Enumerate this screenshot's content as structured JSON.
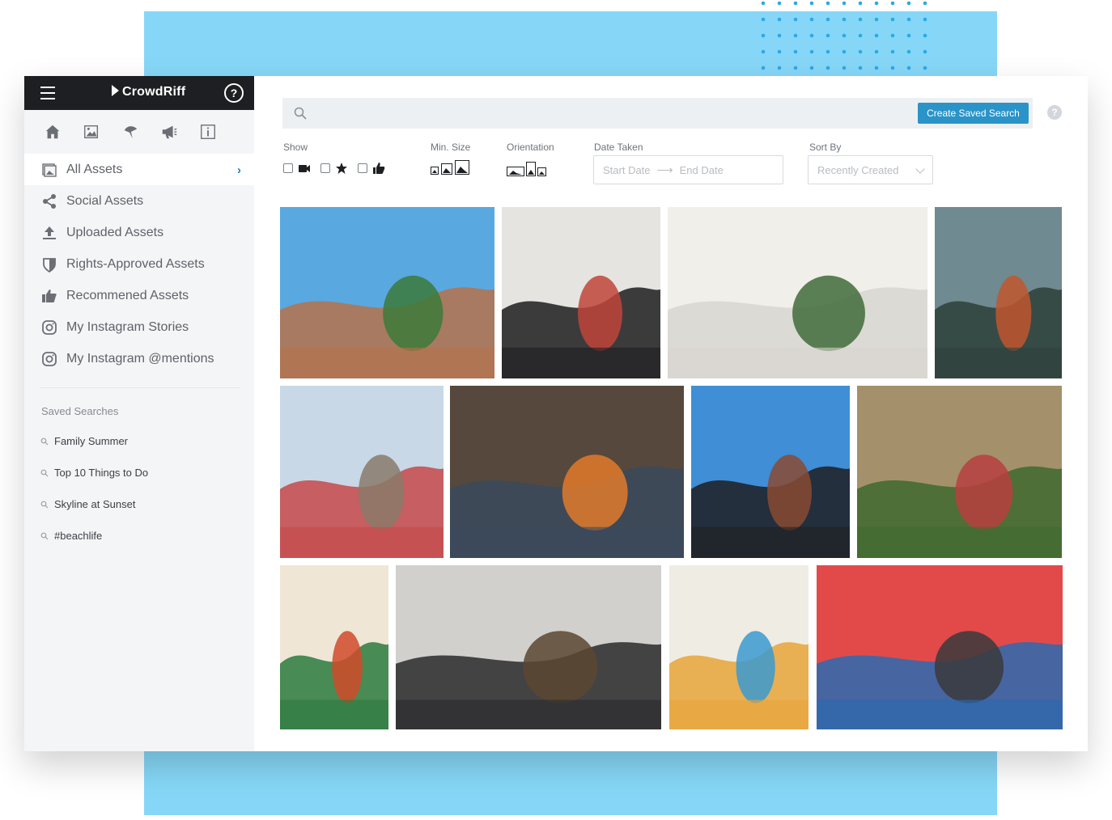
{
  "app": {
    "brand": "CrowdRiff",
    "help_symbol": "?"
  },
  "colors": {
    "accent": "#2a94c8",
    "topbar": "#1d1f22",
    "band": "#86d7f7",
    "sidebar": "#f4f5f7"
  },
  "toolbar_icons": [
    "home-icon",
    "gallery-icon",
    "campaign-icon",
    "megaphone-icon",
    "info-icon"
  ],
  "nav": {
    "items": [
      {
        "label": "All Assets",
        "icon": "all-assets-icon",
        "active": true
      },
      {
        "label": "Social Assets",
        "icon": "share-icon"
      },
      {
        "label": "Uploaded Assets",
        "icon": "upload-icon"
      },
      {
        "label": "Rights-Approved Assets",
        "icon": "shield-icon"
      },
      {
        "label": "Recommened Assets",
        "icon": "thumbs-up-icon"
      },
      {
        "label": "My Instagram Stories",
        "icon": "instagram-icon"
      },
      {
        "label": "My Instagram @mentions",
        "icon": "instagram-icon"
      }
    ]
  },
  "saved_searches": {
    "title": "Saved Searches",
    "items": [
      "Family Summer",
      "Top 10 Things to Do",
      "Skyline at Sunset",
      "#beachlife"
    ]
  },
  "search": {
    "placeholder": "",
    "create_button": "Create Saved Search",
    "help_symbol": "?"
  },
  "filters": {
    "show_label": "Show",
    "min_size_label": "Min. Size",
    "orientation_label": "Orientation",
    "date_label": "Date Taken",
    "start_date_placeholder": "Start Date",
    "end_date_placeholder": "End Date",
    "sort_label": "Sort By",
    "sort_value": "Recently Created"
  },
  "gallery": [
    {
      "name": "photo-park-guell",
      "colors": [
        "#5aa8e0",
        "#b5724a",
        "#3c7a3a"
      ]
    },
    {
      "name": "photo-woman-gate",
      "colors": [
        "#e6e4e0",
        "#1d1d1f",
        "#c0453a"
      ]
    },
    {
      "name": "photo-white-car",
      "colors": [
        "#f1efe9",
        "#d8d6d0",
        "#3f6b3a"
      ]
    },
    {
      "name": "photo-bridge-forest",
      "colors": [
        "#6f8a90",
        "#2e3f3a",
        "#c1562e"
      ]
    },
    {
      "name": "photo-red-street",
      "colors": [
        "#c8d8e6",
        "#c6494a",
        "#8a7a6a"
      ]
    },
    {
      "name": "photo-campfire",
      "colors": [
        "#56483c",
        "#3a4a5c",
        "#e07a2a"
      ]
    },
    {
      "name": "photo-jeep",
      "colors": [
        "#3f8ed6",
        "#1f1f22",
        "#8a4a32"
      ]
    },
    {
      "name": "photo-bicycle-house",
      "colors": [
        "#a4906a",
        "#3f6a2e",
        "#b84040"
      ]
    },
    {
      "name": "photo-green-door",
      "colors": [
        "#efe6d6",
        "#2b7a3e",
        "#d04a2a"
      ]
    },
    {
      "name": "photo-man-hat",
      "colors": [
        "#d2d0cc",
        "#2a2a2c",
        "#5c4632"
      ]
    },
    {
      "name": "photo-mural-walk",
      "colors": [
        "#efece4",
        "#e7a53a",
        "#3a9ad0"
      ]
    },
    {
      "name": "photo-women-drinks",
      "colors": [
        "#e24a4a",
        "#2a6ab0",
        "#3a3a3c"
      ]
    }
  ]
}
